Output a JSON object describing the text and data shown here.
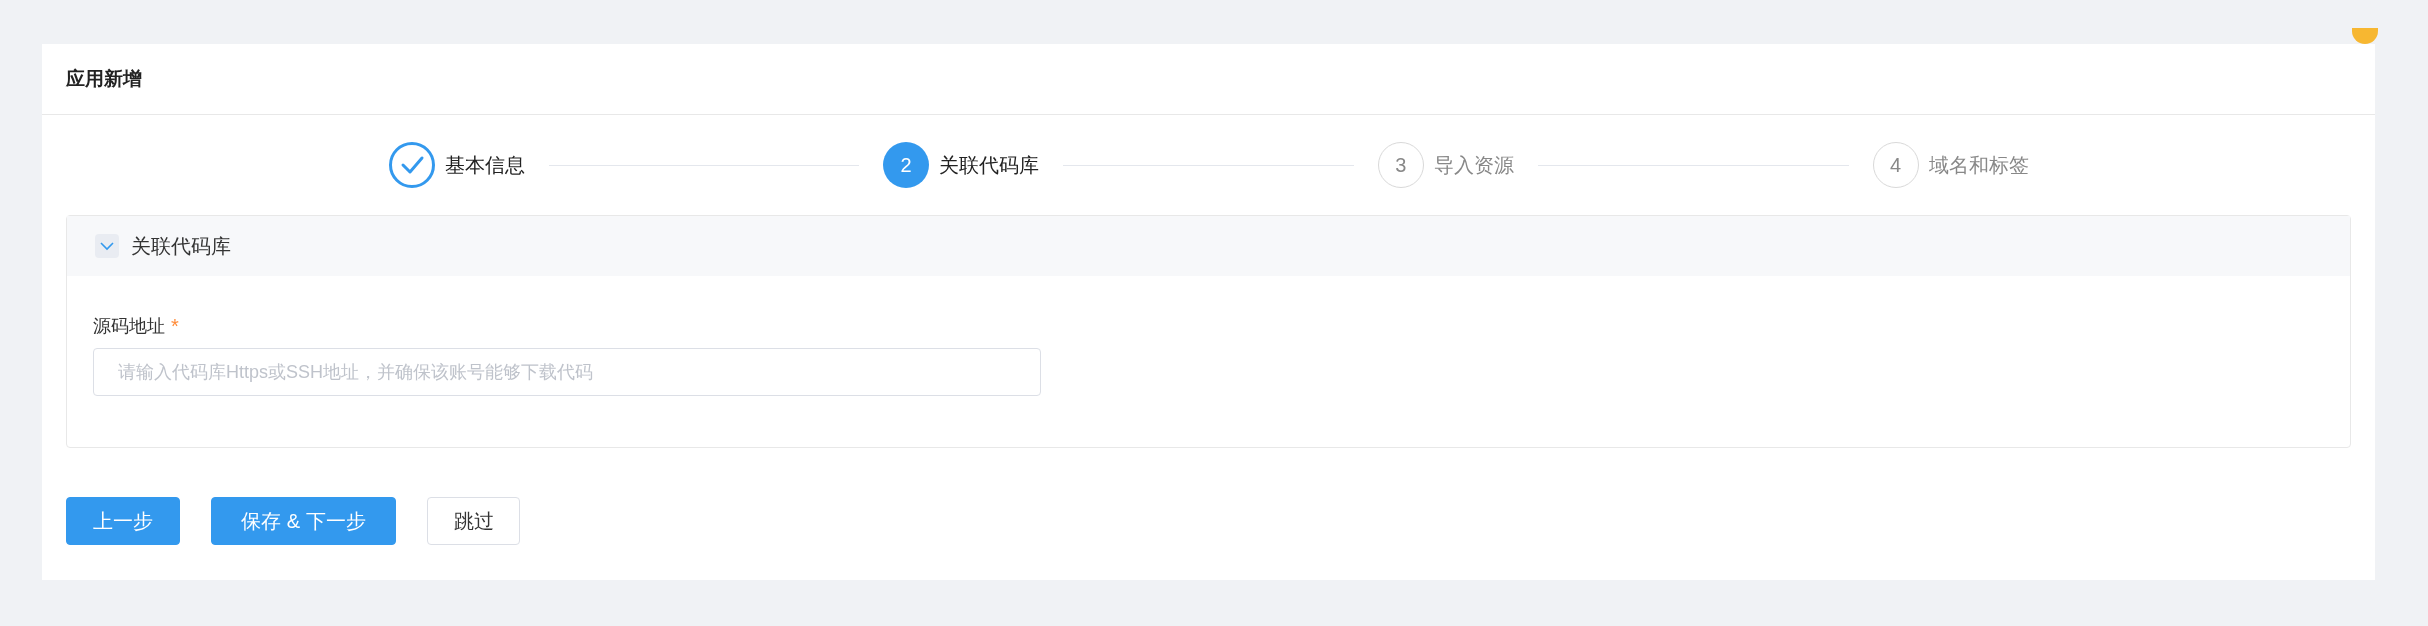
{
  "page": {
    "title": "应用新增"
  },
  "steps": [
    {
      "label": "基本信息",
      "done": true,
      "selected": false
    },
    {
      "number": "2",
      "label": "关联代码库",
      "done": false,
      "selected": true
    },
    {
      "number": "3",
      "label": "导入资源",
      "done": false,
      "selected": false
    },
    {
      "number": "4",
      "label": "域名和标签",
      "done": false,
      "selected": false
    }
  ],
  "panel": {
    "title": "关联代码库",
    "expanded": true,
    "field": {
      "label": "源码地址",
      "required_mark": "*",
      "placeholder": "请输入代码库Https或SSH地址，并确保该账号能够下载代码"
    }
  },
  "buttons": [
    {
      "label": "上一步",
      "kind": "primary"
    },
    {
      "label": "保存 & 下一步",
      "kind": "primary"
    },
    {
      "label": "跳过",
      "kind": "default"
    }
  ]
}
